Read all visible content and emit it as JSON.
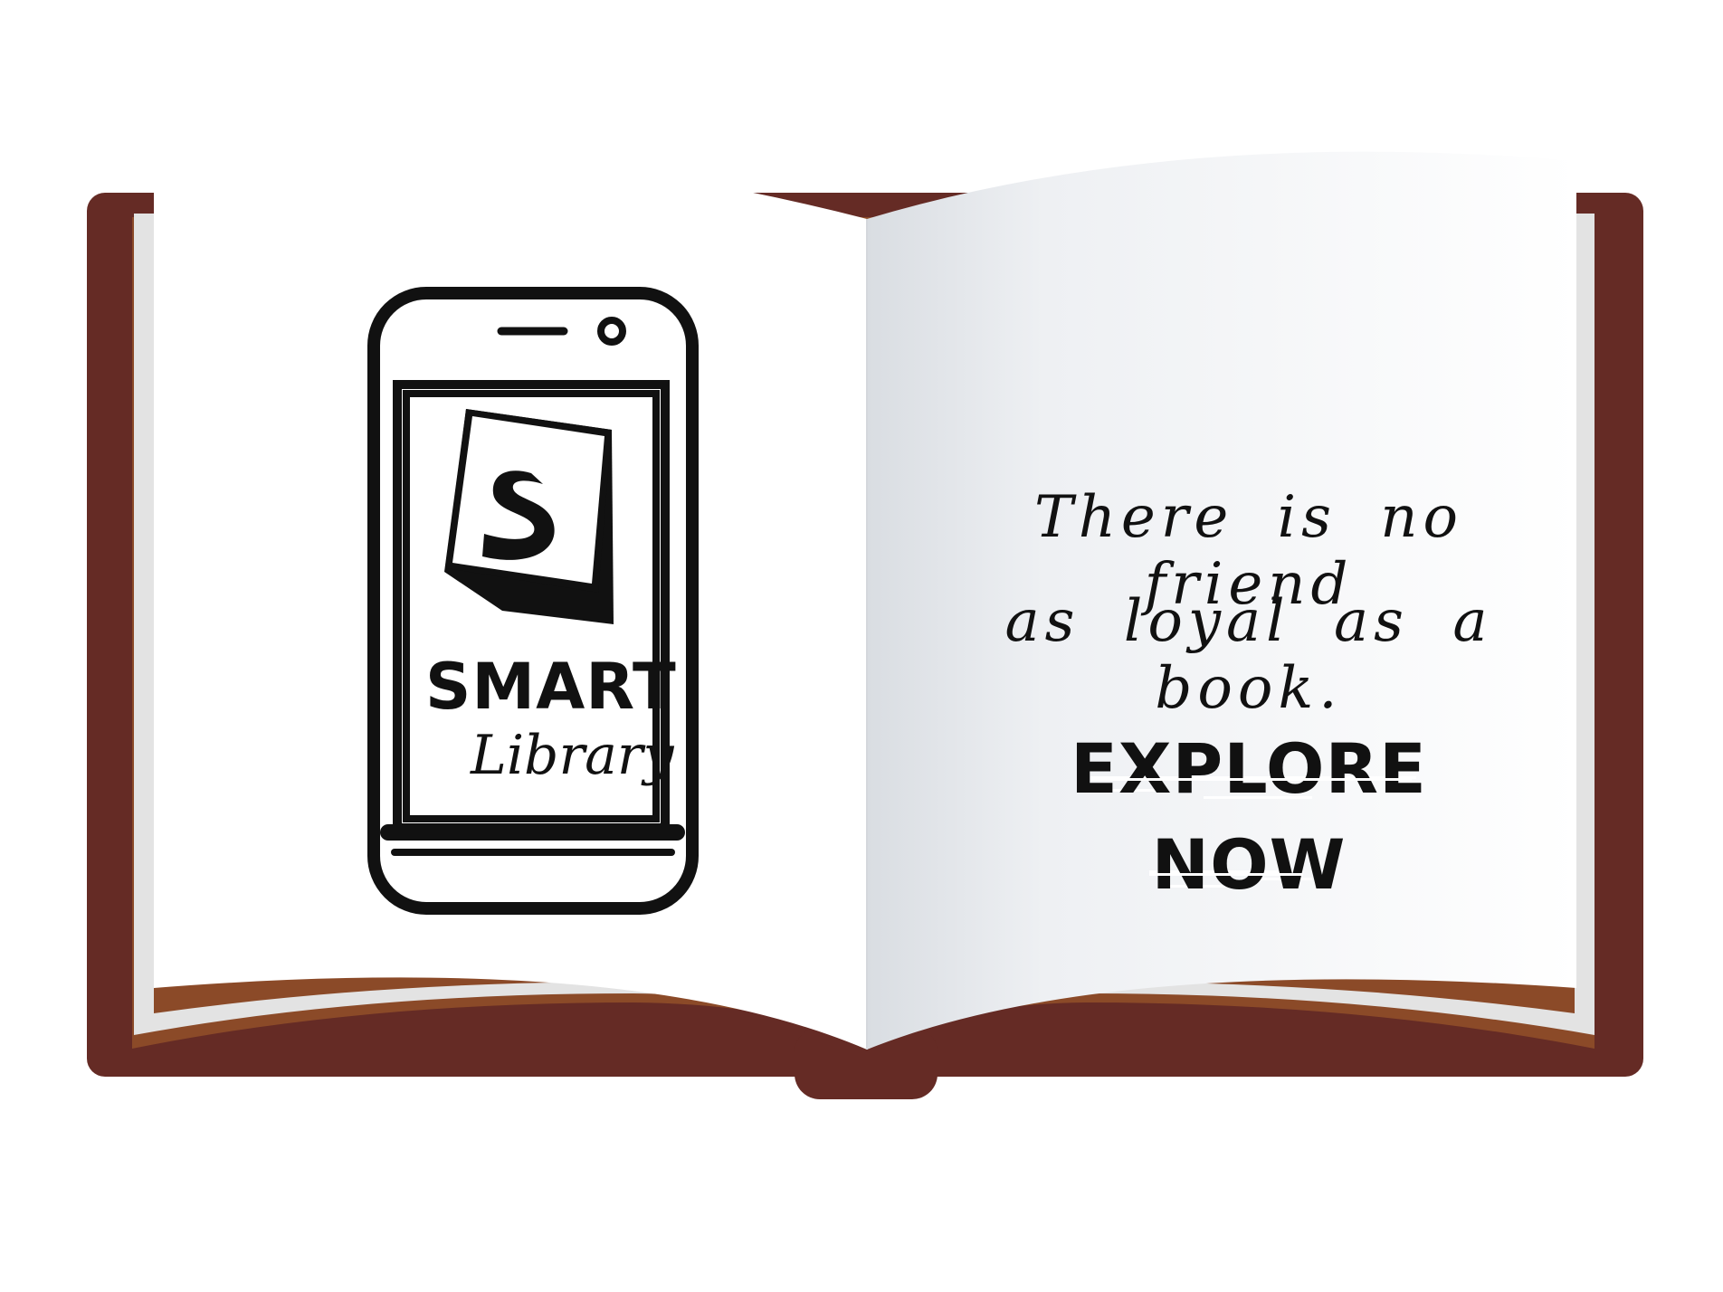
{
  "brand": {
    "logo_letter": "S",
    "name_top": "SMART",
    "name_bottom": "Library"
  },
  "quote": {
    "line1": "There is no friend",
    "line2": "as loyal as a book."
  },
  "cta": {
    "line1": "EXPLORE",
    "line2": "NOW"
  },
  "colors": {
    "cover": "#652b25",
    "page_edge": "#8b4a28",
    "page": "#ffffff",
    "ink": "#111111"
  },
  "icons": {
    "phone": "smartphone-icon",
    "logo": "s-logo-icon",
    "book": "open-book-illustration"
  }
}
